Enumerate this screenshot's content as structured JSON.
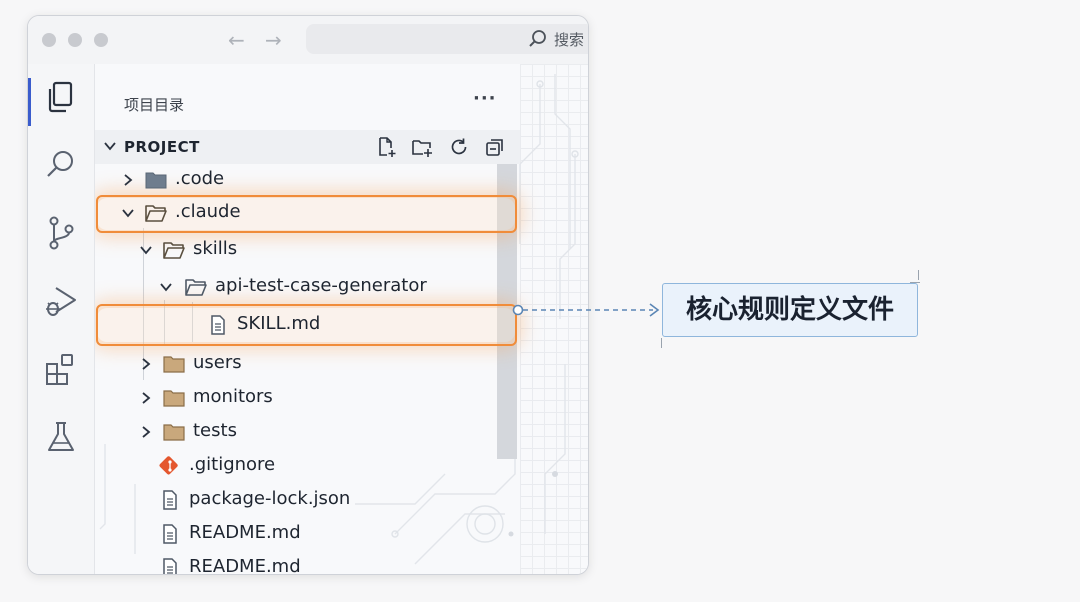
{
  "window": {
    "search_text": "搜索",
    "nav_back": "←",
    "nav_forward": "→"
  },
  "activity_bar": {
    "icons": [
      "explorer-icon",
      "search-icon",
      "source-control-icon",
      "run-debug-icon",
      "extensions-icon",
      "testing-icon"
    ],
    "active": "explorer-icon",
    "accent": "#3a5ccc"
  },
  "explorer": {
    "view_title": "项目目录",
    "more_label": "···",
    "section_title": "PROJECT",
    "toolbar_icons": [
      "new-file-icon",
      "new-folder-icon",
      "refresh-icon",
      "collapse-all-icon"
    ],
    "tree": [
      {
        "name": ".code",
        "type": "folder",
        "expanded": false
      },
      {
        "name": ".claude",
        "type": "folder",
        "expanded": true,
        "highlighted": true
      },
      {
        "name": "skills",
        "type": "folder",
        "expanded": true
      },
      {
        "name": "api-test-case-generator",
        "type": "folder",
        "expanded": true
      },
      {
        "name": "SKILL.md",
        "type": "file",
        "highlighted": true
      },
      {
        "name": "users",
        "type": "folder",
        "expanded": false
      },
      {
        "name": "monitors",
        "type": "folder",
        "expanded": false
      },
      {
        "name": "tests",
        "type": "folder",
        "expanded": false
      },
      {
        "name": ".gitignore",
        "type": "git-file"
      },
      {
        "name": "package-lock.json",
        "type": "file"
      },
      {
        "name": "README.md",
        "type": "file"
      },
      {
        "name": "README.md",
        "type": "file"
      }
    ]
  },
  "annotation": {
    "callout_text": "核心规则定义文件",
    "highlight_color": "#f08c3a",
    "callout_border": "#8fb6dc",
    "callout_bg": "#eaf2fb"
  }
}
